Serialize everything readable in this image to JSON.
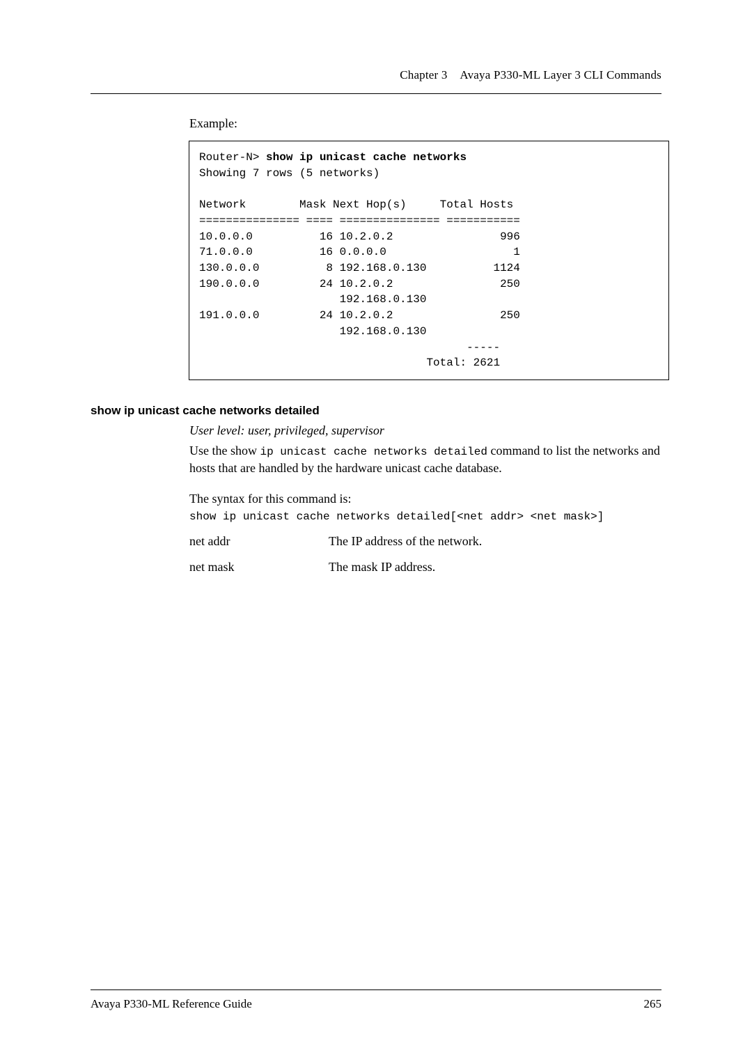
{
  "header": {
    "chapter": "Chapter 3",
    "title": "Avaya P330-ML Layer 3 CLI Commands"
  },
  "example_label": "Example:",
  "code": {
    "prompt": "Router-N> ",
    "command": "show ip unicast cache networks",
    "line2": "Showing 7 rows (5 networks)",
    "blank1": "",
    "header_row": "Network        Mask Next Hop(s)     Total Hosts",
    "sep_row": "=============== ==== =============== ===========",
    "r1": "10.0.0.0          16 10.2.0.2                996",
    "r2": "71.0.0.0          16 0.0.0.0                   1",
    "r3": "130.0.0.0          8 192.168.0.130          1124",
    "r4": "190.0.0.0         24 10.2.0.2                250",
    "r5": "                     192.168.0.130",
    "r6": "191.0.0.0         24 10.2.0.2                250",
    "r7": "                     192.168.0.130",
    "r8": "                                        -----",
    "r9": "                                  Total: 2621"
  },
  "section_heading": "show ip unicast cache networks detailed",
  "user_level": "User level: user, privileged, supervisor",
  "desc": {
    "pre": "Use the show ",
    "mono": "ip unicast cache networks detailed",
    "post": " command to list the networks and hosts that are handled by the hardware unicast cache database."
  },
  "syntax_label": "The syntax for this command is:",
  "syntax_cmd": "show ip unicast cache networks detailed[<net addr> <net mask>]",
  "params": [
    {
      "name": "net addr",
      "desc": "The IP address of the network."
    },
    {
      "name": "net mask",
      "desc": "The mask IP address."
    }
  ],
  "footer": {
    "left": "Avaya P330-ML Reference Guide",
    "right": "265"
  }
}
